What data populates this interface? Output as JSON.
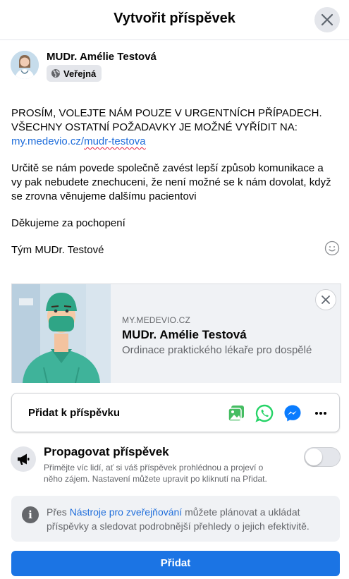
{
  "dialog": {
    "title": "Vytvořit příspěvek"
  },
  "author": {
    "name": "MUDr. Amélie Testová",
    "privacy_label": "Veřejná"
  },
  "post": {
    "line1": "PROSÍM, VOLEJTE NÁM POUZE V URGENTNÍCH PŘÍPADECH.",
    "line2": "VŠECHNY OSTATNÍ POŽADAVKY JE MOŽNÉ VYŘÍDIT NA:",
    "link_prefix": "my.medevio.cz/",
    "link_suffix": "mudr-testova",
    "para2_line1": "Určitě se nám povede společně zavést lepší způsob komunikace a",
    "para2_line2": "vy pak nebudete znechuceni, že není možné se k nám dovolat, když",
    "para2_line3": "se zrovna věnujeme dalšímu pacientovi",
    "thanks": "Děkujeme za pochopení",
    "signature": "Tým MUDr. Testové"
  },
  "link_preview": {
    "domain": "MY.MEDEVIO.CZ",
    "title": "MUDr. Amélie Testová",
    "description": "Ordinace praktického lékaře pro dospělé"
  },
  "add_to_post": {
    "label": "Přidat k příspěvku",
    "icons": [
      "photo-video-icon",
      "whatsapp-icon",
      "messenger-icon",
      "more-icon"
    ]
  },
  "promote": {
    "title": "Propagovat příspěvek",
    "description_line1": "Přimějte víc lidí, ať si váš příspěvek prohlédnou a projeví o",
    "description_line2": "něho zájem. Nastavení můžete upravit po kliknutí na Přidat.",
    "enabled": false
  },
  "info": {
    "prefix": "Přes ",
    "link": "Nástroje pro zveřejňování",
    "rest_line1": " můžete plánovat a ukládat",
    "line2": "příspěvky a sledovat podrobnější přehledy o jejich efektivitě."
  },
  "submit_label": "Přidat",
  "colors": {
    "accent": "#1b74e4",
    "link": "#216fdb",
    "whatsapp": "#25d366",
    "photo": "#45bd62",
    "messenger": "#0a7cff"
  }
}
